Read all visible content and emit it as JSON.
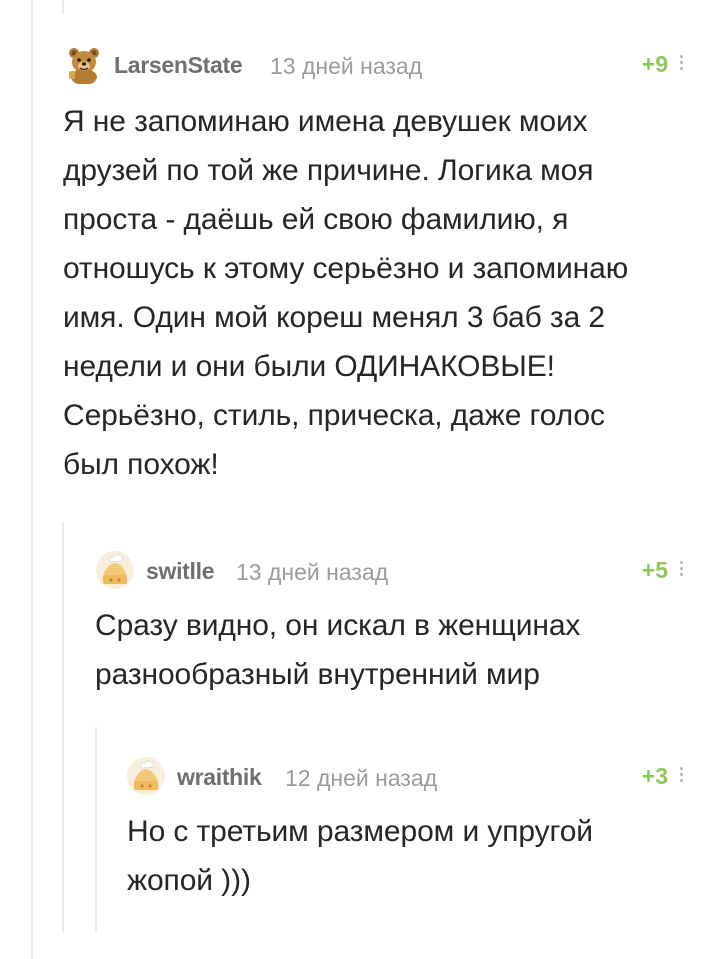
{
  "comments": [
    {
      "username": "LarsenState",
      "time": "13 дней назад",
      "rating": "+9",
      "text": "Я не запоминаю имена девушек моих\nдрузей по той же причине. Логика моя\nпроста - даёшь ей свою фамилию, я\nотношусь к этому серьёзно и запоминаю\nимя. Один мой кореш менял 3 баб за 2\nнедели и они были ОДИНАКОВЫЕ!\nСерьёзно, стиль, прическа, даже голос\nбыл похож!",
      "avatar_icon": "bear-avatar-icon"
    },
    {
      "username": "switlle",
      "time": "13 дней назад",
      "rating": "+5",
      "text": "Сразу видно, он искал в женщинах\nразнообразный внутренний мир",
      "avatar_icon": "default-avatar-icon"
    },
    {
      "username": "wraithik",
      "time": "12 дней назад",
      "rating": "+3",
      "text": "Но с третьим размером и упругой\nжопой )))",
      "avatar_icon": "default-avatar-icon"
    }
  ],
  "colors": {
    "rating": "#8ac858",
    "username": "#6f6f6f",
    "time": "#9b9b9b",
    "text": "#262626",
    "thread_line": "#e9e9e9"
  }
}
